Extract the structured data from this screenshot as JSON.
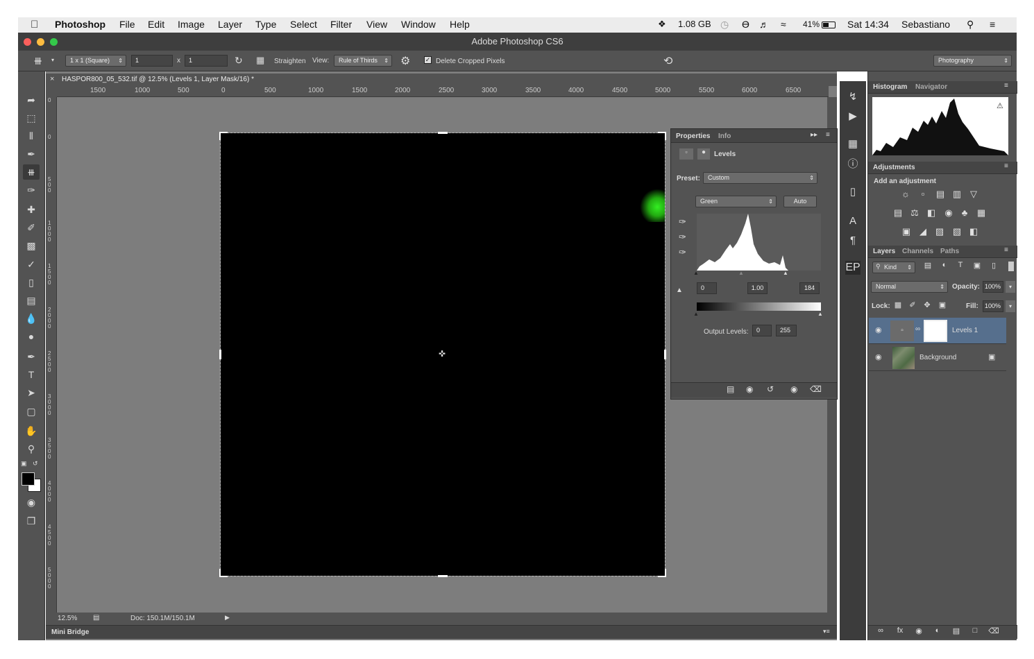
{
  "menubar": {
    "app": "Photoshop",
    "items": [
      "File",
      "Edit",
      "Image",
      "Layer",
      "Type",
      "Select",
      "Filter",
      "View",
      "Window",
      "Help"
    ],
    "status": {
      "storage": "1.08 GB",
      "battery": "41%",
      "clock": "Sat 14:34",
      "user": "Sebastiano"
    }
  },
  "window": {
    "title": "Adobe Photoshop CS6"
  },
  "options": {
    "ratio": "1 x 1 (Square)",
    "width": "1",
    "x_sep": "x",
    "height": "1",
    "straighten": "Straighten",
    "view_label": "View:",
    "view_value": "Rule of Thirds",
    "delete_cropped": "Delete Cropped Pixels",
    "workspace": "Photography"
  },
  "document": {
    "tab_title": "HASPOR800_05_532.tif @ 12.5% (Levels 1, Layer Mask/16) *",
    "ruler_h": [
      "1500",
      "1000",
      "500",
      "0",
      "500",
      "1000",
      "1500",
      "2000",
      "2500",
      "3000",
      "3500",
      "4000",
      "4500",
      "5000",
      "5500",
      "6000",
      "6500"
    ],
    "ruler_v": [
      "0",
      "0",
      "500",
      "1000",
      "1500",
      "2000",
      "2500",
      "3000",
      "3500",
      "4000",
      "4500",
      "5000"
    ],
    "zoom": "12.5%",
    "doc_size": "Doc: 150.1M/150.1M"
  },
  "mini_bridge": "Mini Bridge",
  "properties": {
    "tabs": [
      "Properties",
      "Info"
    ],
    "title": "Levels",
    "preset_label": "Preset:",
    "preset": "Custom",
    "channel": "Green",
    "auto": "Auto",
    "input_levels": [
      "0",
      "1.00",
      "184"
    ],
    "output_label": "Output Levels:",
    "output_levels": [
      "0",
      "255"
    ]
  },
  "histogram_panel": {
    "tabs": [
      "Histogram",
      "Navigator"
    ]
  },
  "adjustments": {
    "tab": "Adjustments",
    "subtitle": "Add an adjustment"
  },
  "layers_panel": {
    "tabs": [
      "Layers",
      "Channels",
      "Paths"
    ],
    "filter": "Kind",
    "blend": "Normal",
    "opacity_label": "Opacity:",
    "opacity": "100%",
    "lock_label": "Lock:",
    "fill_label": "Fill:",
    "fill": "100%",
    "layers": [
      {
        "name": "Levels 1"
      },
      {
        "name": "Background"
      }
    ]
  },
  "colors": {
    "accent": "#566f8d",
    "ui": "#535353",
    "dark": "#3c3c3c",
    "green_speck": "#33ee22"
  }
}
